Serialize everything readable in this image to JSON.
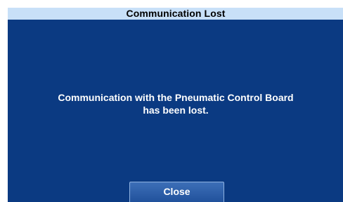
{
  "dialog": {
    "title": "Communication Lost",
    "message_line1": "Communication with the Pneumatic Control Board",
    "message_line2": "has been lost.",
    "close_label": "Close"
  },
  "colors": {
    "title_bar_bg": "#c8e0f8",
    "dialog_bg": "#0b3a82",
    "button_bg": "#2a5aa6",
    "text_light": "#ffffff"
  }
}
